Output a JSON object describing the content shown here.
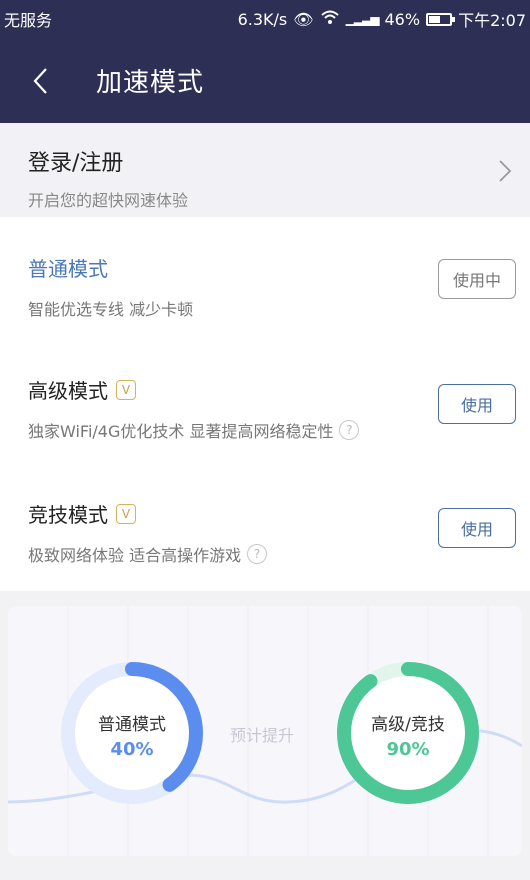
{
  "status_bar": {
    "carrier": "无服务",
    "speed": "6.3K/s",
    "battery": "46%",
    "time": "下午2:07"
  },
  "header": {
    "title": "加速模式",
    "back_icon": "back-arrow"
  },
  "login": {
    "title": "登录/注册",
    "subtitle": "开启您的超快网速体验"
  },
  "modes": [
    {
      "name": "普通模式",
      "desc": "智能优选专线 减少卡顿",
      "button": "使用中",
      "vip": false,
      "help": false,
      "active": true
    },
    {
      "name": "高级模式",
      "desc": "独家WiFi/4G优化技术 显著提高网络稳定性",
      "button": "使用",
      "vip": true,
      "help": true,
      "active": false
    },
    {
      "name": "竞技模式",
      "desc": "极致网络体验 适合高操作游戏",
      "button": "使用",
      "vip": true,
      "help": true,
      "active": false
    }
  ],
  "vip_badge": "V",
  "help_badge": "?",
  "comparison": {
    "middle_label": "预计提升",
    "left": {
      "name": "普通模式",
      "value": "40%",
      "fraction": 0.4,
      "color": "#5b8def"
    },
    "right": {
      "name": "高级/竞技",
      "value": "90%",
      "fraction": 0.9,
      "color": "#4cc795"
    }
  }
}
